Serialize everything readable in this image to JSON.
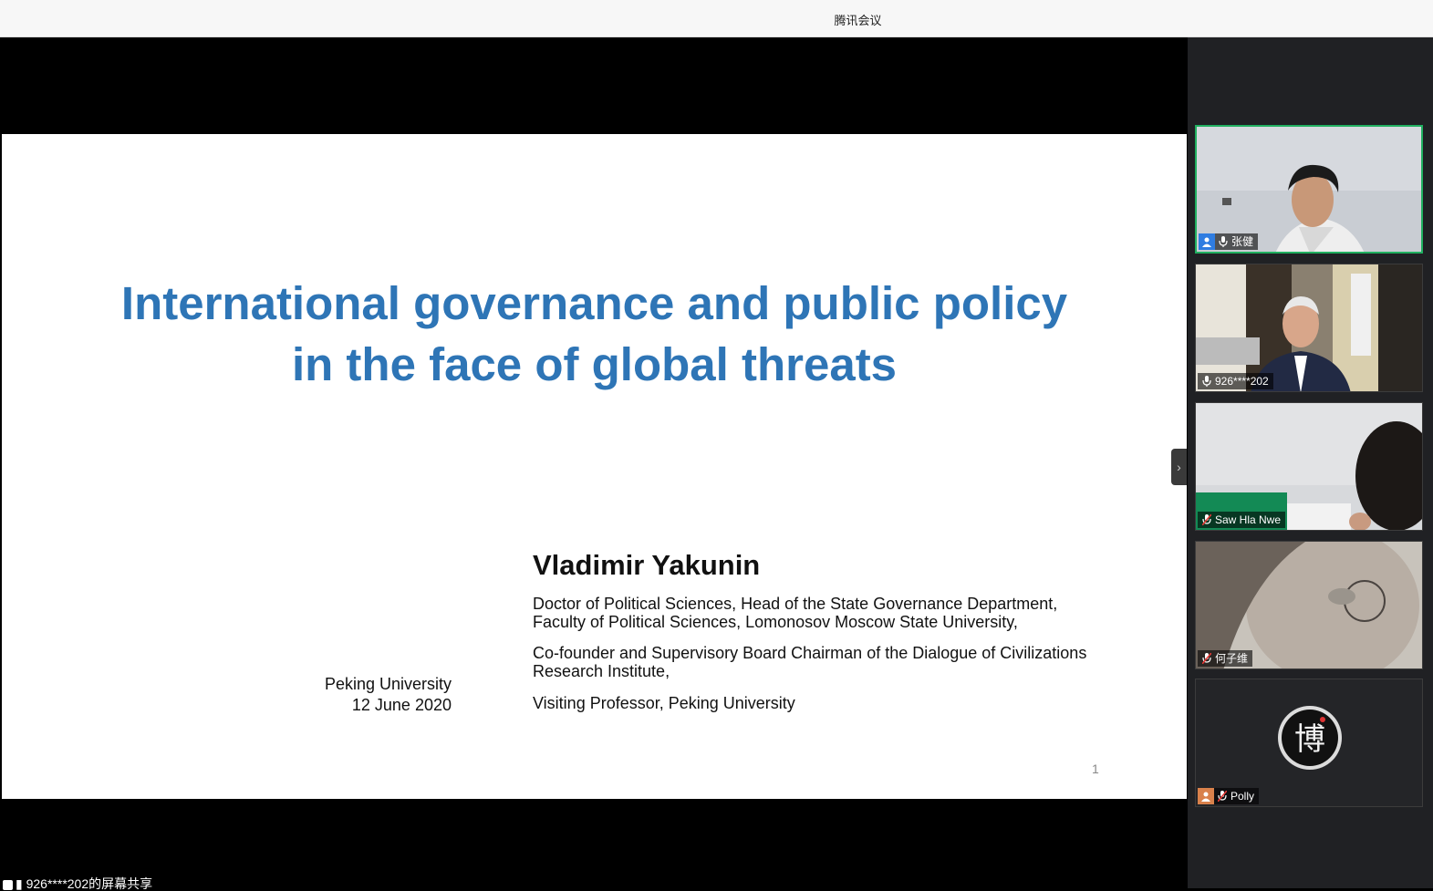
{
  "window": {
    "title": "腾讯会议"
  },
  "slide": {
    "title_line1": "International governance and public policy",
    "title_line2": "in the face of global threats",
    "author": "Vladimir Yakunin",
    "desc1_line1": "Doctor of Political Sciences, Head of the State Governance Department,",
    "desc1_line2": "Faculty of Political Sciences, Lomonosov Moscow State University,",
    "desc2_line1": "Co-founder and Supervisory Board Chairman of the Dialogue of Civilizations",
    "desc2_line2": "Research Institute,",
    "desc3": "Visiting Professor, Peking University",
    "venue_line1": "Peking University",
    "venue_line2": "12 June 2020",
    "page_number": "1"
  },
  "participants": [
    {
      "name": "张健",
      "icon": "user-icon",
      "mic": "on",
      "active": true
    },
    {
      "name": "926****202",
      "icon": "",
      "mic": "on",
      "active": false
    },
    {
      "name": "Saw Hla Nwe",
      "icon": "",
      "mic": "muted",
      "active": false
    },
    {
      "name": "何子维",
      "icon": "",
      "mic": "muted",
      "active": false
    },
    {
      "name": "Polly",
      "icon": "user-icon",
      "mic": "muted",
      "active": false,
      "avatar_glyph": "博"
    }
  ],
  "footer": {
    "status": "926****202的屏幕共享"
  },
  "colors": {
    "accent_title": "#2e75b6",
    "active_border": "#20b060",
    "sidebar_bg": "#202124"
  }
}
